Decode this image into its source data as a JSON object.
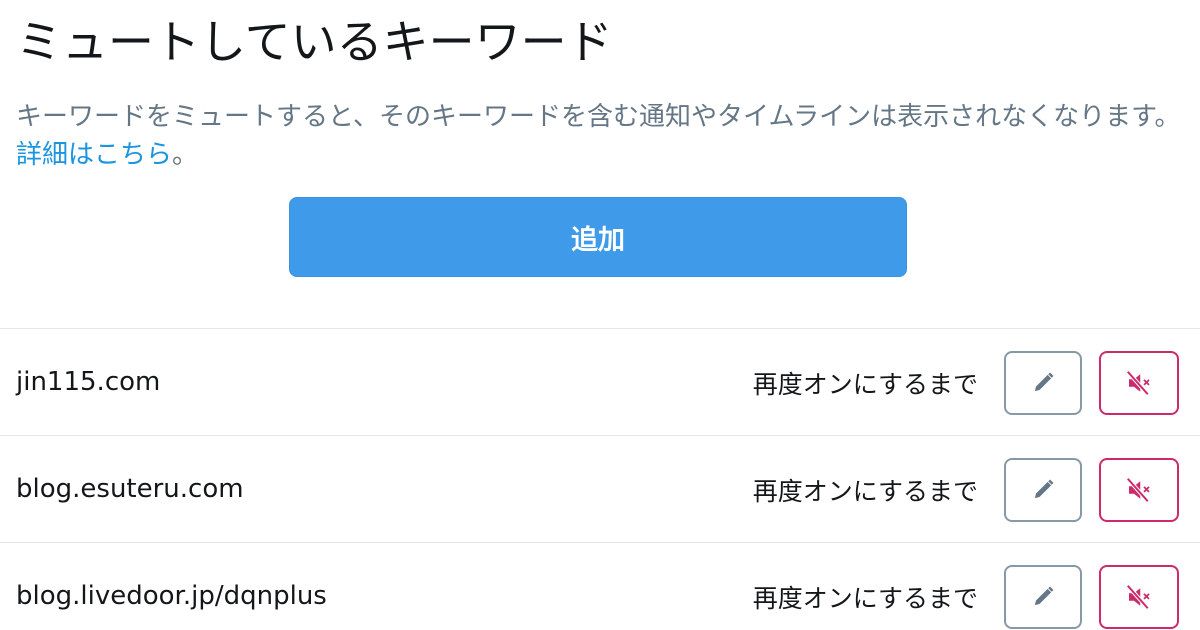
{
  "header": {
    "title": "ミュートしているキーワード"
  },
  "description": {
    "text": "キーワードをミュートすると、そのキーワードを含む通知やタイムラインは表示されなくなります。",
    "link_label": "詳細はこちら",
    "suffix": "。"
  },
  "add_button": {
    "label": "追加"
  },
  "colors": {
    "accent": "#3f9be9",
    "link": "#1b95e0",
    "mute_red": "#cc2a6a",
    "muted_text": "#657786"
  },
  "keywords": [
    {
      "keyword": "jin115.com",
      "duration": "再度オンにするまで",
      "edit_icon": "pencil-icon",
      "unmute_icon": "speaker-muted-icon"
    },
    {
      "keyword": "blog.esuteru.com",
      "duration": "再度オンにするまで",
      "edit_icon": "pencil-icon",
      "unmute_icon": "speaker-muted-icon"
    },
    {
      "keyword": "blog.livedoor.jp/dqnplus",
      "duration": "再度オンにするまで",
      "edit_icon": "pencil-icon",
      "unmute_icon": "speaker-muted-icon"
    }
  ]
}
